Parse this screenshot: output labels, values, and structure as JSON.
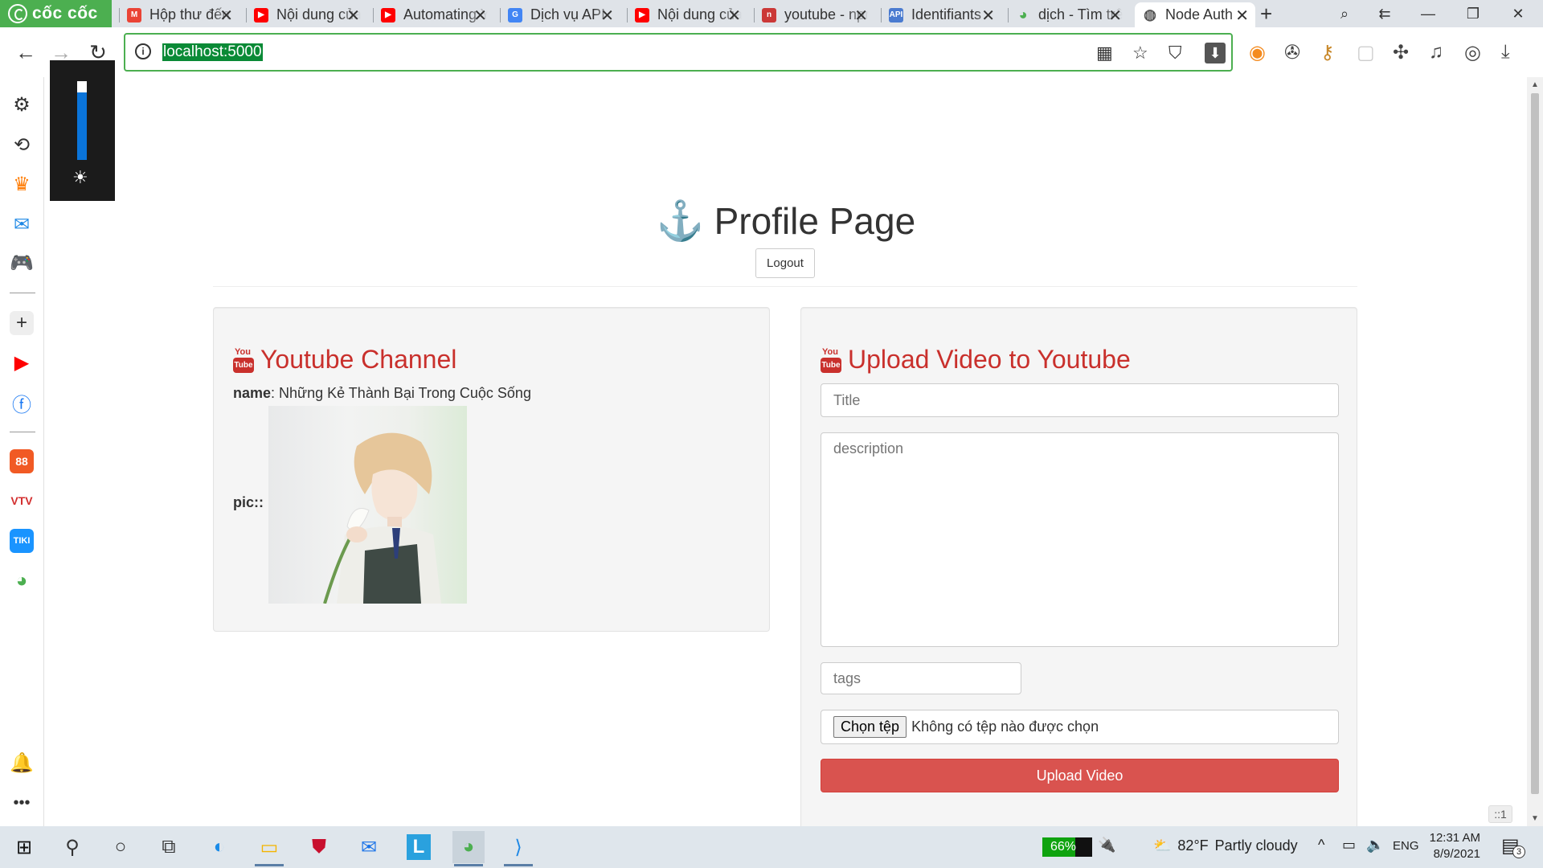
{
  "browser": {
    "brand": "cốc cốc",
    "tabs": [
      {
        "label": "Hộp thư đến",
        "favicon": "gmail-icon",
        "color": "#ea4335"
      },
      {
        "label": "Nội dung của kênh",
        "favicon": "youtube-icon",
        "color": "#ff0000"
      },
      {
        "label": "Automating YouTube",
        "favicon": "youtube-icon",
        "color": "#ff0000"
      },
      {
        "label": "Dịch vụ API",
        "favicon": "google-icon",
        "color": "#4285f4"
      },
      {
        "label": "Nội dung của kênh",
        "favicon": "youtube-icon",
        "color": "#ff0000"
      },
      {
        "label": "youtube - npm",
        "favicon": "npm-icon",
        "color": "#cb3837"
      },
      {
        "label": "Identifiants",
        "favicon": "api-icon",
        "color": "#4a7bd0"
      },
      {
        "label": "dịch - Tìm trên Cốc Cốc",
        "favicon": "coccoc-icon",
        "color": "#4caf50"
      },
      {
        "label": "Node Auth",
        "favicon": "globe-icon",
        "color": "#555555"
      }
    ],
    "active_tab_index": 8,
    "url": "localhost:5000"
  },
  "page": {
    "title": "Profile Page",
    "logout_label": "Logout",
    "channel": {
      "heading": "Youtube Channel",
      "name_label": "name",
      "name_value": ": Những Kẻ Thành Bại Trong Cuộc Sống",
      "pic_label": "pic::",
      "yt_you": "You",
      "yt_tube": "Tube"
    },
    "upload": {
      "heading": "Upload Video to Youtube",
      "title_placeholder": "Title",
      "description_placeholder": "description",
      "tags_placeholder": "tags",
      "file_button": "Chọn tệp",
      "file_status": "Không có tệp nào được chọn",
      "submit_label": "Upload Video"
    }
  },
  "overlay": {
    "zoom_chip": "::1",
    "brightness_level": 0.86
  },
  "taskbar": {
    "battery": "66%",
    "battery_level": 0.66,
    "weather_temp": "82°F",
    "weather_desc": "Partly cloudy",
    "language": "ENG",
    "time": "12:31 AM",
    "date": "8/9/2021",
    "notification_count": "3"
  },
  "colors": {
    "accent_red": "#d9534f",
    "heading_red": "#c9302c",
    "browser_green": "#4caf50"
  }
}
